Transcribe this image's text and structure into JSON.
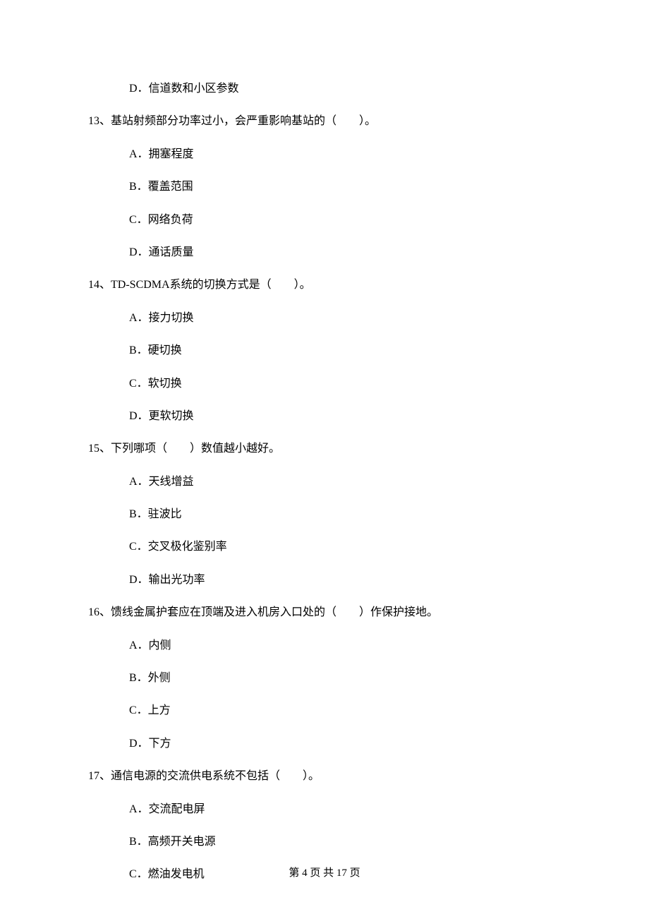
{
  "orphan_option": "D．信道数和小区参数",
  "questions": [
    {
      "num": "13",
      "stem": "基站射频部分功率过小，会严重影响基站的（　　）。",
      "options": [
        "A．拥塞程度",
        "B．覆盖范围",
        "C．网络负荷",
        "D．通话质量"
      ]
    },
    {
      "num": "14",
      "stem": "TD-SCDMA系统的切换方式是（　　）。",
      "options": [
        "A．接力切换",
        "B．硬切换",
        "C．软切换",
        "D．更软切换"
      ]
    },
    {
      "num": "15",
      "stem": "下列哪项（　　）数值越小越好。",
      "options": [
        "A．天线增益",
        "B．驻波比",
        "C．交叉极化鉴别率",
        "D．输出光功率"
      ]
    },
    {
      "num": "16",
      "stem": "馈线金属护套应在顶端及进入机房入口处的（　　）作保护接地。",
      "options": [
        "A．内侧",
        "B．外侧",
        "C．上方",
        "D．下方"
      ]
    },
    {
      "num": "17",
      "stem": "通信电源的交流供电系统不包括（　　）。",
      "options": [
        "A．交流配电屏",
        "B．高频开关电源",
        "C．燃油发电机"
      ]
    }
  ],
  "footer": "第 4 页 共 17 页"
}
